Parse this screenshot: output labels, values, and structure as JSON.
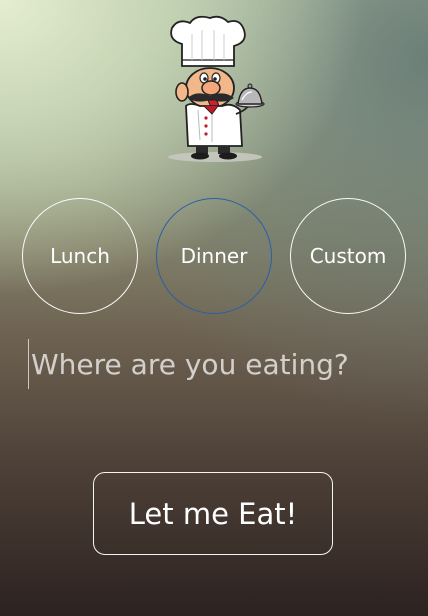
{
  "meals": [
    {
      "label": "Lunch",
      "selected": false
    },
    {
      "label": "Dinner",
      "selected": true
    },
    {
      "label": "Custom",
      "selected": false
    }
  ],
  "location_input": {
    "placeholder": "Where are you eating?",
    "value": ""
  },
  "eat_button": {
    "label": "Let me Eat!"
  },
  "colors": {
    "selected_ring": "#2a5fa8",
    "ring": "#ffffff"
  },
  "icons": {
    "header": "chef-icon"
  }
}
